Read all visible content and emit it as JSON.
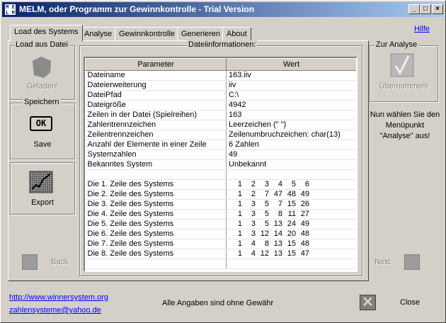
{
  "window": {
    "title": "MELM, oder Programm zur Gewinnkontrolle - Trial Version",
    "icon_text": "M E L M"
  },
  "titlebar_buttons": {
    "minimize": "_",
    "maximize": "□",
    "close": "×"
  },
  "tabs": [
    {
      "label": "Load des Systems",
      "active": true
    },
    {
      "label": "Analyse"
    },
    {
      "label": "Gewinnkontrolle"
    },
    {
      "label": "Generieren"
    },
    {
      "label": "About"
    }
  ],
  "help_link": "Hilfe",
  "left_panel": {
    "load_group": "Load aus Datei",
    "load_status": "Geladen!",
    "save_group": "Speichern",
    "ok_icon_text": "OK",
    "save_label": "Save",
    "export_label": "Export"
  },
  "file_info": {
    "group_title": "Dateiinformationen:",
    "columns": [
      "Parameter",
      "Wert"
    ],
    "rows": [
      {
        "param": "Dateiname",
        "value": "163.iiv"
      },
      {
        "param": "Dateierweiterung",
        "value": "iiv"
      },
      {
        "param": "DateiPfad",
        "value": "C:\\"
      },
      {
        "param": "Dateigröße",
        "value": "4942"
      },
      {
        "param": "Zeilen in der Datei (Spielreihen)",
        "value": "163"
      },
      {
        "param": "Zahlentrennzeichen",
        "value": "Leerzeichen (\" \")"
      },
      {
        "param": "Zeilentrennzeichen",
        "value": "Zeilenumbruchzeichen: char(13)"
      },
      {
        "param": "Anzahl der Elemente in einer Zeile",
        "value": "6 Zahlen"
      },
      {
        "param": "Systemzahlen",
        "value": "49"
      },
      {
        "param": "Bekanntes System",
        "value": "Unbekannt"
      }
    ],
    "system_rows": [
      {
        "label": "Die 1. Zeile des Systems",
        "numbers": [
          "1",
          "2",
          "3",
          "4",
          "5",
          "6"
        ]
      },
      {
        "label": "Die 2. Zeile des Systems",
        "numbers": [
          "1",
          "2",
          "7",
          "47",
          "48",
          "49"
        ]
      },
      {
        "label": "Die 3. Zeile des Systems",
        "numbers": [
          "1",
          "3",
          "5",
          "7",
          "15",
          "26"
        ]
      },
      {
        "label": "Die 4. Zeile des Systems",
        "numbers": [
          "1",
          "3",
          "5",
          "8",
          "11",
          "27"
        ]
      },
      {
        "label": "Die 5. Zeile des Systems",
        "numbers": [
          "1",
          "3",
          "5",
          "13",
          "24",
          "49"
        ]
      },
      {
        "label": "Die 6. Zeile des Systems",
        "numbers": [
          "1",
          "3",
          "12",
          "14",
          "20",
          "48"
        ]
      },
      {
        "label": "Die 7. Zeile des Systems",
        "numbers": [
          "1",
          "4",
          "8",
          "13",
          "15",
          "48"
        ]
      },
      {
        "label": "Die 8. Zeile des Systems",
        "numbers": [
          "1",
          "4",
          "12",
          "13",
          "15",
          "47"
        ]
      }
    ]
  },
  "right_panel": {
    "group": "Zur Analyse",
    "status": "Übernommen!",
    "hint": "Nun wählen Sie den Menüpunkt \"Analyse\" aus!"
  },
  "nav": {
    "back": "Back",
    "next": "Next"
  },
  "footer": {
    "link_site": "http://www.winnersystem.org",
    "link_email": "zahlensysteme@yahoo.de",
    "disclaimer": "Alle Angaben sind ohne Gewähr",
    "close_label": "Close",
    "close_icon_text": "✕"
  }
}
